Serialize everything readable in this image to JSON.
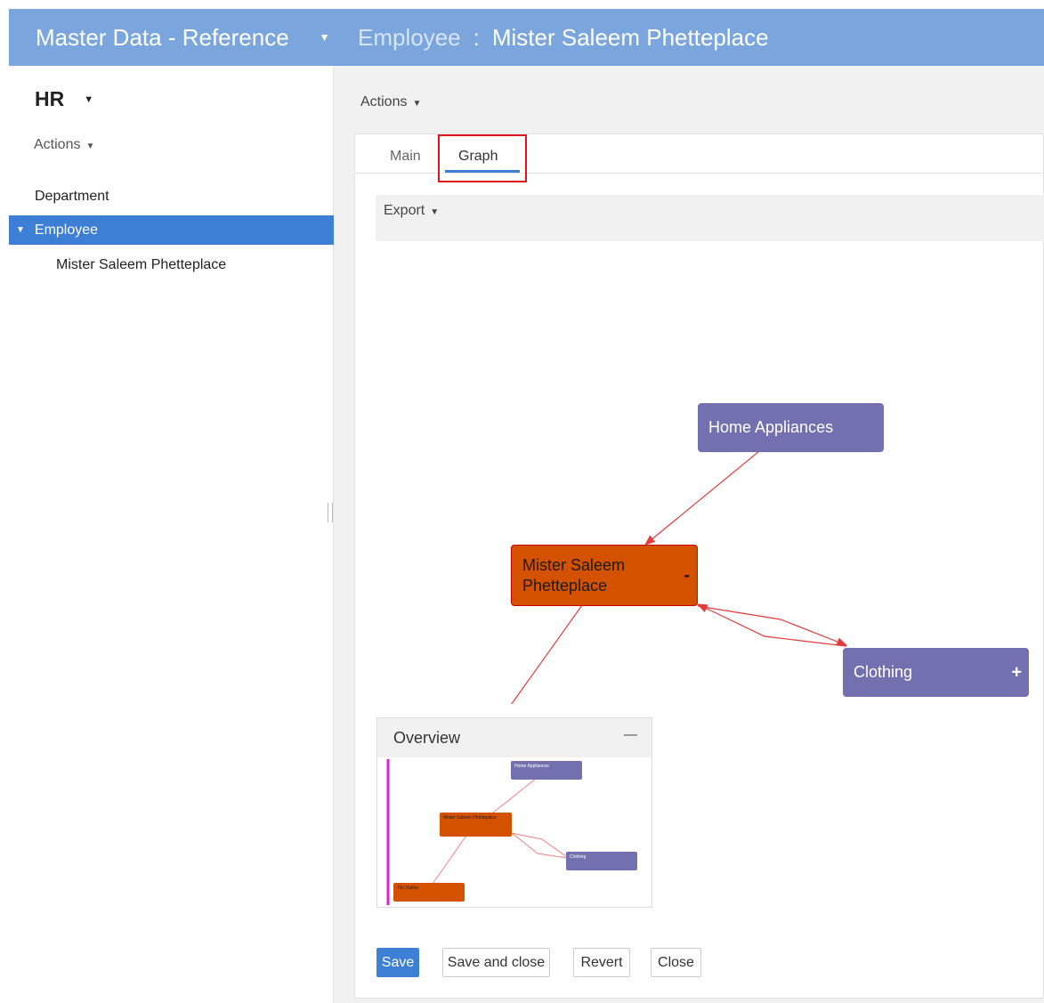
{
  "header": {
    "app_title": "Master Data - Reference",
    "entity": "Employee",
    "separator": ":",
    "record": "Mister Saleem Phetteplace"
  },
  "sidebar": {
    "model": "HR",
    "actions_label": "Actions",
    "items": [
      {
        "label": "Department"
      },
      {
        "label": "Employee"
      },
      {
        "label": "Mister Saleem Phetteplace"
      }
    ]
  },
  "main": {
    "actions_label": "Actions",
    "tabs": [
      {
        "label": "Main"
      },
      {
        "label": "Graph"
      }
    ],
    "export_label": "Export"
  },
  "graph": {
    "nodes": [
      {
        "label": "Home Appliances",
        "toggle": ""
      },
      {
        "label": "Mister Saleem Phetteplace",
        "toggle": "-"
      },
      {
        "label": "Clothing",
        "toggle": "+"
      },
      {
        "label": "Tito Daldry",
        "toggle": "+"
      }
    ],
    "colors": {
      "purple": "#7370b0",
      "orange": "#d45100",
      "edge": "#e23b3b"
    }
  },
  "overview": {
    "title": "Overview"
  },
  "footer": {
    "save": "Save",
    "save_close": "Save and close",
    "revert": "Revert",
    "close": "Close"
  },
  "colors": {
    "header": "#7aa6dd",
    "accent": "#3e7fd6",
    "highlight": "#e0141b"
  }
}
